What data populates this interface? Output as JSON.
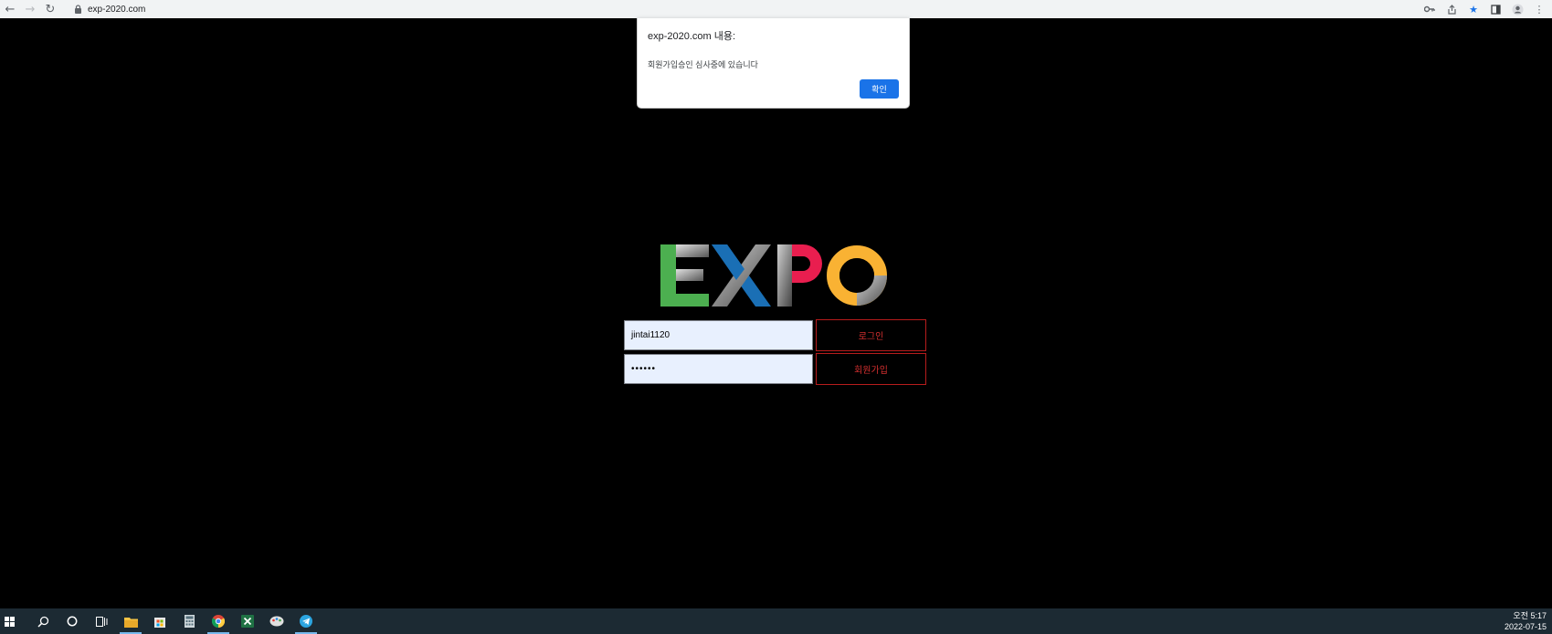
{
  "browser": {
    "url": "exp-2020.com",
    "icons": [
      "back-icon",
      "forward-icon",
      "reload-icon",
      "lock-icon",
      "key-icon",
      "share-icon",
      "star-icon",
      "sidepanel-icon",
      "profile-icon",
      "more-icon"
    ]
  },
  "alert": {
    "title": "exp-2020.com 내용:",
    "message": "회원가입승인 심사중에 있습니다",
    "ok_label": "확인"
  },
  "logo": {
    "text": "EXPO",
    "colors": {
      "E": "#4caf50",
      "X": "#1a6fb5",
      "P": "#e91e4f",
      "O": "#f9b233",
      "gray": "#8a8a8a"
    }
  },
  "login": {
    "username_value": "jintai1120",
    "password_value": "••••••",
    "login_label": "로그인",
    "join_label": "회원가입"
  },
  "taskbar": {
    "icons": [
      "windows-start-icon",
      "search-icon",
      "cortana-icon",
      "task-view-icon",
      "file-explorer-icon",
      "store-icon",
      "calculator-icon",
      "chrome-icon",
      "excel-icon",
      "paint-icon",
      "telegram-icon"
    ],
    "time": "오전 5:17",
    "date": "2022-07-15"
  }
}
